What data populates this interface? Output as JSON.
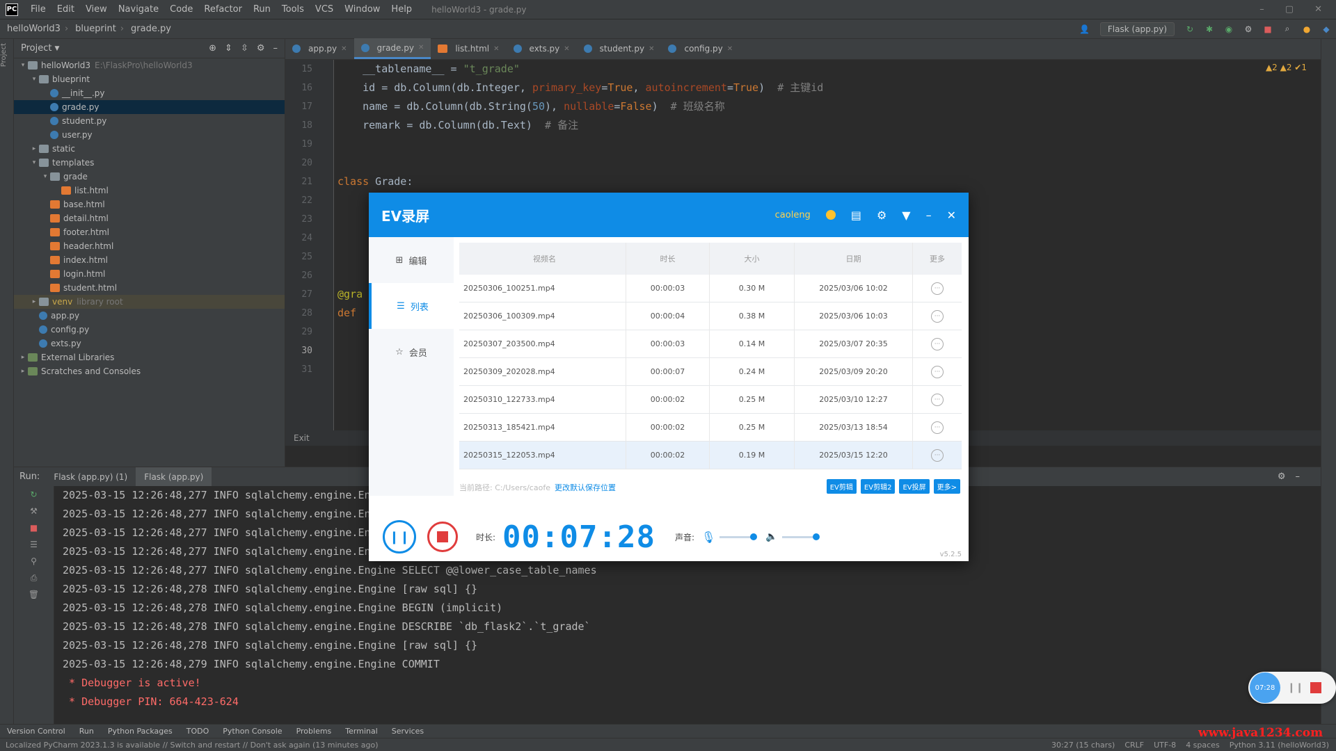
{
  "menubar": {
    "items": [
      "File",
      "Edit",
      "View",
      "Navigate",
      "Code",
      "Refactor",
      "Run",
      "Tools",
      "VCS",
      "Window",
      "Help"
    ],
    "window_title": "helloWorld3 - grade.py"
  },
  "navbar": {
    "crumbs": [
      "helloWorld3",
      "blueprint",
      "grade.py"
    ],
    "run_config": "Flask (app.py)"
  },
  "project": {
    "header": "Project",
    "tree": [
      {
        "label": "helloWorld3",
        "hint": "E:\\FlaskPro\\helloWorld3",
        "indent": 0,
        "type": "folder",
        "arrow": "▾"
      },
      {
        "label": "blueprint",
        "indent": 1,
        "type": "folder",
        "arrow": "▾"
      },
      {
        "label": "__init__.py",
        "indent": 2,
        "type": "py"
      },
      {
        "label": "grade.py",
        "indent": 2,
        "type": "py",
        "selected": true
      },
      {
        "label": "student.py",
        "indent": 2,
        "type": "py"
      },
      {
        "label": "user.py",
        "indent": 2,
        "type": "py"
      },
      {
        "label": "static",
        "indent": 1,
        "type": "folder",
        "arrow": "▸"
      },
      {
        "label": "templates",
        "indent": 1,
        "type": "folder",
        "arrow": "▾"
      },
      {
        "label": "grade",
        "indent": 2,
        "type": "folder",
        "arrow": "▾"
      },
      {
        "label": "list.html",
        "indent": 3,
        "type": "html"
      },
      {
        "label": "base.html",
        "indent": 2,
        "type": "html"
      },
      {
        "label": "detail.html",
        "indent": 2,
        "type": "html"
      },
      {
        "label": "footer.html",
        "indent": 2,
        "type": "html"
      },
      {
        "label": "header.html",
        "indent": 2,
        "type": "html"
      },
      {
        "label": "index.html",
        "indent": 2,
        "type": "html"
      },
      {
        "label": "login.html",
        "indent": 2,
        "type": "html"
      },
      {
        "label": "student.html",
        "indent": 2,
        "type": "html"
      },
      {
        "label": "venv",
        "hint": "library root",
        "indent": 1,
        "type": "folder",
        "arrow": "▸",
        "excluded": true
      },
      {
        "label": "app.py",
        "indent": 1,
        "type": "py"
      },
      {
        "label": "config.py",
        "indent": 1,
        "type": "py"
      },
      {
        "label": "exts.py",
        "indent": 1,
        "type": "py"
      },
      {
        "label": "External Libraries",
        "indent": 0,
        "type": "lib",
        "arrow": "▸"
      },
      {
        "label": "Scratches and Consoles",
        "indent": 0,
        "type": "lib",
        "arrow": "▸"
      }
    ]
  },
  "tabs": [
    {
      "label": "app.py",
      "active": false
    },
    {
      "label": "grade.py",
      "active": true
    },
    {
      "label": "list.html",
      "active": false
    },
    {
      "label": "exts.py",
      "active": false
    },
    {
      "label": "student.py",
      "active": false
    },
    {
      "label": "config.py",
      "active": false
    }
  ],
  "editor": {
    "inspections": "▲2  ▲2  ✔1",
    "line_numbers": [
      "15",
      "16",
      "17",
      "18",
      "19",
      "20",
      "21",
      "22",
      "23",
      "24",
      "25",
      "26",
      "27",
      "28",
      "29",
      "30",
      "31"
    ],
    "current_line": "30",
    "breadcrumb": "Exit"
  },
  "run_panel": {
    "label": "Run:",
    "tabs": [
      "Flask (app.py) (1)",
      "Flask (app.py)"
    ],
    "log_lines": [
      "2025-03-15 12:26:48,277 INFO sqlalchemy.engine.Engine SELECT DATABASE()",
      "2025-03-15 12:26:48,277 INFO sqlalchemy.engine.Engine [raw sql] {}",
      "2025-03-15 12:26:48,277 INFO sqlalchemy.engine.Engine SELECT @@sql_mode",
      "2025-03-15 12:26:48,277 INFO sqlalchemy.engine.Engine [raw sql] {}",
      "2025-03-15 12:26:48,277 INFO sqlalchemy.engine.Engine SELECT @@lower_case_table_names",
      "2025-03-15 12:26:48,278 INFO sqlalchemy.engine.Engine [raw sql] {}",
      "2025-03-15 12:26:48,278 INFO sqlalchemy.engine.Engine BEGIN (implicit)",
      "2025-03-15 12:26:48,278 INFO sqlalchemy.engine.Engine DESCRIBE `db_flask2`.`t_grade`",
      "2025-03-15 12:26:48,278 INFO sqlalchemy.engine.Engine [raw sql] {}",
      "2025-03-15 12:26:48,279 INFO sqlalchemy.engine.Engine COMMIT"
    ],
    "debugger_lines": [
      " * Debugger is active!",
      " * Debugger PIN: 664-423-624"
    ]
  },
  "bottom_tabs": [
    "Version Control",
    "Run",
    "Python Packages",
    "TODO",
    "Python Console",
    "Problems",
    "Terminal",
    "Services"
  ],
  "status": {
    "message": "Localized PyCharm 2023.1.3 is available // Switch and restart // Don't ask again (13 minutes ago)",
    "right": [
      "30:27 (15 chars)",
      "CRLF",
      "UTF-8",
      "4 spaces",
      "Python 3.11 (helloWorld3)"
    ]
  },
  "ev": {
    "title": "EV录屏",
    "user": "caoleng",
    "nav": [
      {
        "label": "编辑",
        "icon": "grid-icon",
        "active": false
      },
      {
        "label": "列表",
        "icon": "list-icon",
        "active": true
      },
      {
        "label": "会员",
        "icon": "star-icon",
        "active": false
      }
    ],
    "columns": [
      "视频名",
      "时长",
      "大小",
      "日期",
      "更多"
    ],
    "rows": [
      {
        "name": "20250306_100251.mp4",
        "duration": "00:00:03",
        "size": "0.30 M",
        "date": "2025/03/06 10:02"
      },
      {
        "name": "20250306_100309.mp4",
        "duration": "00:00:04",
        "size": "0.38 M",
        "date": "2025/03/06 10:03"
      },
      {
        "name": "20250307_203500.mp4",
        "duration": "00:00:03",
        "size": "0.14 M",
        "date": "2025/03/07 20:35"
      },
      {
        "name": "20250309_202028.mp4",
        "duration": "00:00:07",
        "size": "0.24 M",
        "date": "2025/03/09 20:20"
      },
      {
        "name": "20250310_122733.mp4",
        "duration": "00:00:02",
        "size": "0.25 M",
        "date": "2025/03/10 12:27"
      },
      {
        "name": "20250313_185421.mp4",
        "duration": "00:00:02",
        "size": "0.25 M",
        "date": "2025/03/13 18:54"
      },
      {
        "name": "20250315_122053.mp4",
        "duration": "00:00:02",
        "size": "0.19 M",
        "date": "2025/03/15 12:20",
        "selected": true
      }
    ],
    "path_label": "当前路径: C:/Users/caofe",
    "path_link": "更改默认保存位置",
    "buttons": [
      "EV剪辑",
      "EV剪辑2",
      "EV投屏",
      "更多>"
    ],
    "duration_label": "时长:",
    "timer": "00:07:28",
    "sound_label": "声音:",
    "version": "v5.2.5"
  },
  "float_widget": {
    "time": "07:28"
  },
  "watermark": "www.java1234.com",
  "colors": {
    "accent": "#0f8ce6",
    "stop": "#e03c3c",
    "ide_bg": "#2b2b2b",
    "panel_bg": "#3c3f41"
  }
}
